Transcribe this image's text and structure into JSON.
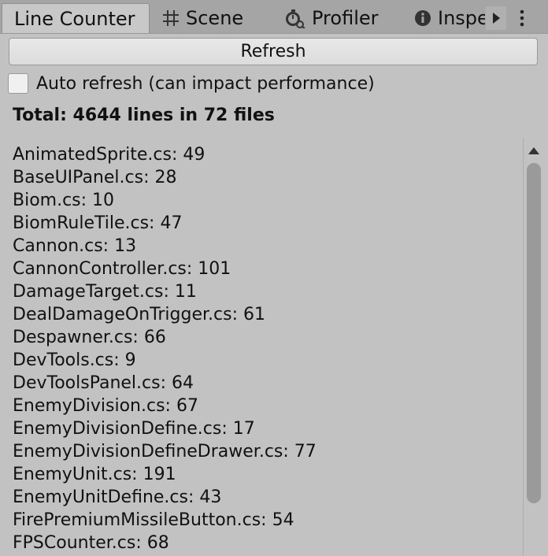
{
  "tabs": [
    {
      "label": "Line Counter"
    },
    {
      "label": "Scene",
      "icon": "grid-icon"
    },
    {
      "label": "Profiler",
      "icon": "stopwatch-icon"
    },
    {
      "label": "Inspe",
      "icon": "info-icon"
    }
  ],
  "toolbar": {
    "refresh_label": "Refresh"
  },
  "auto_refresh": {
    "label": "Auto refresh (can impact performance)",
    "checked": false
  },
  "summary": {
    "total_text": "Total: 4644 lines in 72 files"
  },
  "files": [
    {
      "text": "AnimatedSprite.cs: 49"
    },
    {
      "text": "BaseUIPanel.cs: 28"
    },
    {
      "text": "Biom.cs: 10"
    },
    {
      "text": "BiomRuleTile.cs: 47"
    },
    {
      "text": "Cannon.cs: 13"
    },
    {
      "text": "CannonController.cs: 101"
    },
    {
      "text": "DamageTarget.cs: 11"
    },
    {
      "text": "DealDamageOnTrigger.cs: 61"
    },
    {
      "text": "Despawner.cs: 66"
    },
    {
      "text": "DevTools.cs: 9"
    },
    {
      "text": "DevToolsPanel.cs: 64"
    },
    {
      "text": "EnemyDivision.cs: 67"
    },
    {
      "text": "EnemyDivisionDefine.cs: 17"
    },
    {
      "text": "EnemyDivisionDefineDrawer.cs: 77"
    },
    {
      "text": "EnemyUnit.cs: 191"
    },
    {
      "text": "EnemyUnitDefine.cs: 43"
    },
    {
      "text": "FirePremiumMissileButton.cs: 54"
    },
    {
      "text": "FPSCounter.cs: 68"
    }
  ]
}
